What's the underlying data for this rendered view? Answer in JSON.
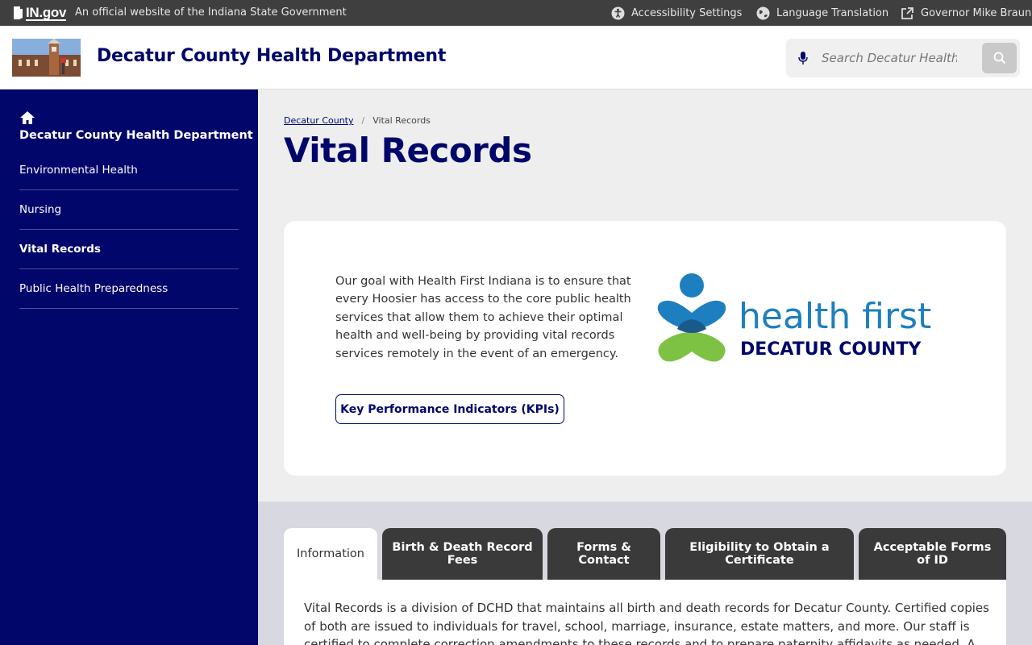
{
  "topbar": {
    "logo_text": "IN.gov",
    "official_text": "An official website of the Indiana State Government",
    "links": [
      {
        "label": "Accessibility Settings",
        "icon": "accessibility-icon"
      },
      {
        "label": "Language Translation",
        "icon": "globe-icon"
      },
      {
        "label": "Governor Mike Braun",
        "icon": "external-link-icon"
      }
    ]
  },
  "header": {
    "title": "Decatur County Health Department",
    "search_placeholder": "Search Decatur Health"
  },
  "sidebar": {
    "home_label": "Decatur County Health Department",
    "items": [
      {
        "label": "Environmental Health"
      },
      {
        "label": "Nursing"
      },
      {
        "label": "Vital Records",
        "active": true
      },
      {
        "label": "Public Health Preparedness"
      }
    ]
  },
  "breadcrumb": {
    "parent": "Decatur County",
    "current": "Vital Records"
  },
  "page": {
    "title": "Vital Records",
    "intro": "Our goal with Health First Indiana is to ensure that every Hoosier has access to the core public health services that allow them to achieve their optimal health and well-being by providing vital records services remotely in the event of an emergency.",
    "kpi_button": "Key Performance Indicators (KPIs)",
    "logo": {
      "line1": "health first",
      "line2": "DECATUR COUNTY"
    }
  },
  "tabs": [
    {
      "label": "Information",
      "active": true
    },
    {
      "label": "Birth & Death Record Fees"
    },
    {
      "label": "Forms & Contact"
    },
    {
      "label": "Eligibility to Obtain a Certificate"
    },
    {
      "label": "Acceptable Forms of ID"
    }
  ],
  "panel": {
    "text": "Vital Records is a division of DCHD that maintains all birth and death records for Decatur County. Certified copies of both are issued to individuals for travel, school, marriage, insurance, estate matters, and more. Our staff is certified to complete correction amendments to these records and to prepare paternity affidavits as needed. A"
  },
  "colors": {
    "brand_navy": "#00066a",
    "topbar": "#3f3f3f",
    "logo_blue": "#1e7fc0",
    "logo_green": "#7dc242"
  }
}
